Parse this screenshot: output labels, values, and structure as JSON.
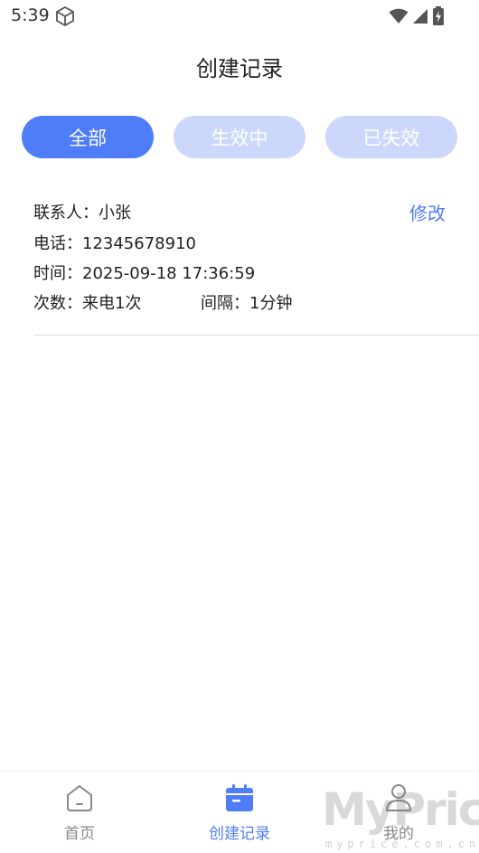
{
  "status_bar": {
    "time": "5:39"
  },
  "page": {
    "title": "创建记录"
  },
  "tabs": [
    {
      "label": "全部",
      "active": true
    },
    {
      "label": "生效中",
      "active": false
    },
    {
      "label": "已失效",
      "active": false
    }
  ],
  "record": {
    "contact": "联系人：小张",
    "phone": "电话：12345678910",
    "time": "时间：2025-09-18 17:36:59",
    "count": "次数：来电1次",
    "interval": "间隔：1分钟",
    "edit_label": "修改"
  },
  "bottom_nav": {
    "items": [
      {
        "label": "首页",
        "icon": "home-icon",
        "active": false
      },
      {
        "label": "创建记录",
        "icon": "calendar-icon",
        "active": true
      },
      {
        "label": "我的",
        "icon": "person-icon",
        "active": false
      }
    ]
  },
  "watermark": {
    "main": "MyPrice",
    "sub": "myprice.com.cn"
  },
  "colors": {
    "accent": "#4f7cf7",
    "tab_inactive": "#ccd8fb",
    "nav_inactive": "#888888"
  }
}
